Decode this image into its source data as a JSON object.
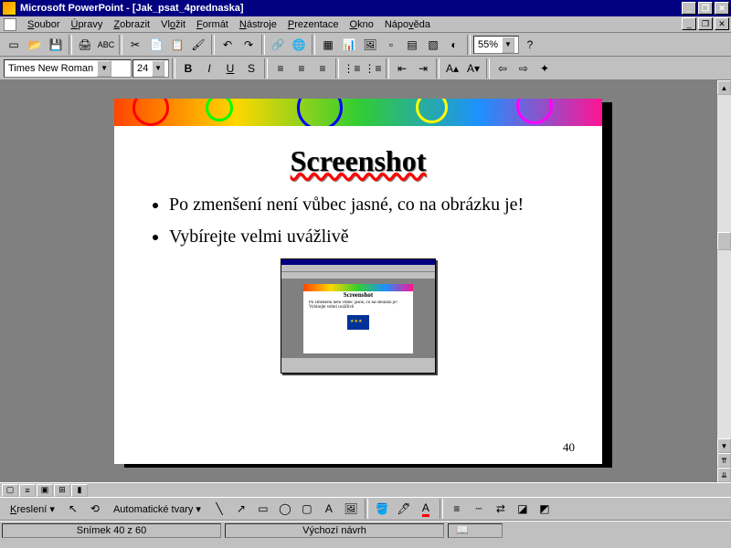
{
  "titlebar": {
    "app": "Microsoft PowerPoint",
    "doc": "[Jak_psat_4prednaska]"
  },
  "menu": {
    "soubor": "Soubor",
    "upravy": "Úpravy",
    "zobrazit": "Zobrazit",
    "vlozit": "Vložit",
    "format": "Formát",
    "nastroje": "Nástroje",
    "prezentace": "Prezentace",
    "okno": "Okno",
    "napoveda": "Nápověda"
  },
  "toolbar": {
    "zoom": "55%"
  },
  "format": {
    "font_name": "Times New Roman",
    "font_size": "24",
    "bold": "B",
    "italic": "I",
    "underline": "U",
    "shadow": "S",
    "fontgrow": "A",
    "fontshrink": "A"
  },
  "slide": {
    "title": "Screenshot",
    "bullet1": "Po zmenšení není vůbec jasné, co na obrázku je!",
    "bullet2": "Vybírejte velmi uvážlivě",
    "pagenum": "40",
    "inner_title": "Screenshot",
    "inner_b1": "Po zmenšení není vůbec jasné, co na obrázku je!",
    "inner_b2": "Vybírejte velmi uvážlivě"
  },
  "draw": {
    "kresleni": "Kreslení",
    "autoshapes": "Automatické tvary"
  },
  "status": {
    "slide_pos": "Snímek 40 z 60",
    "design": "Výchozí návrh"
  }
}
